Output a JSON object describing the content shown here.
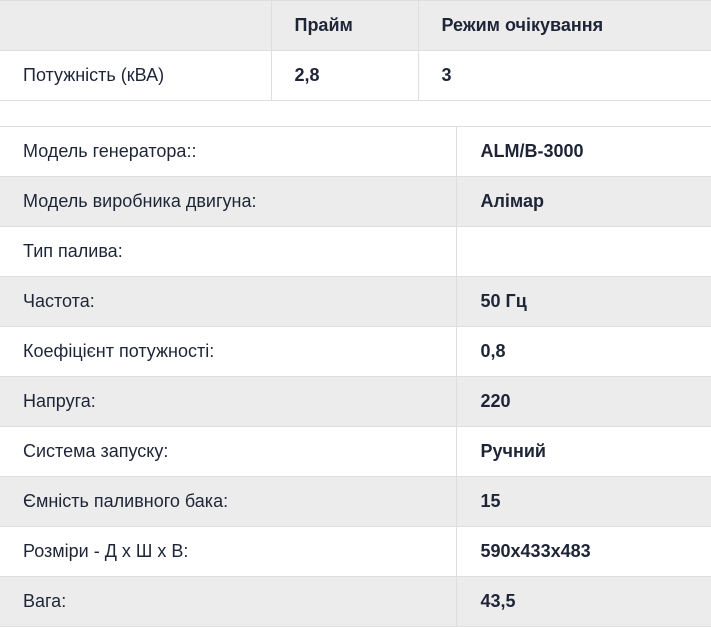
{
  "power_table": {
    "headers": [
      "",
      "Прайм",
      "Режим очікування"
    ],
    "row": {
      "label": "Потужність (кВА)",
      "prime": "2,8",
      "standby": "3"
    }
  },
  "specs": [
    {
      "label": "Модель генератора::",
      "value": "ALM/B-3000"
    },
    {
      "label": "Модель виробника двигуна:",
      "value": "Алімар"
    },
    {
      "label": "Тип палива:",
      "value": ""
    },
    {
      "label": "Частота:",
      "value": "50 Гц"
    },
    {
      "label": "Коефіцієнт потужності:",
      "value": "0,8"
    },
    {
      "label": "Напруга:",
      "value": "220"
    },
    {
      "label": "Система запуску:",
      "value": "Ручний"
    },
    {
      "label": "Ємність паливного бака:",
      "value": "15"
    },
    {
      "label": "Розміри - Д х Ш х В:",
      "value": "590x433x483"
    },
    {
      "label": "Вага:",
      "value": "43,5"
    }
  ]
}
